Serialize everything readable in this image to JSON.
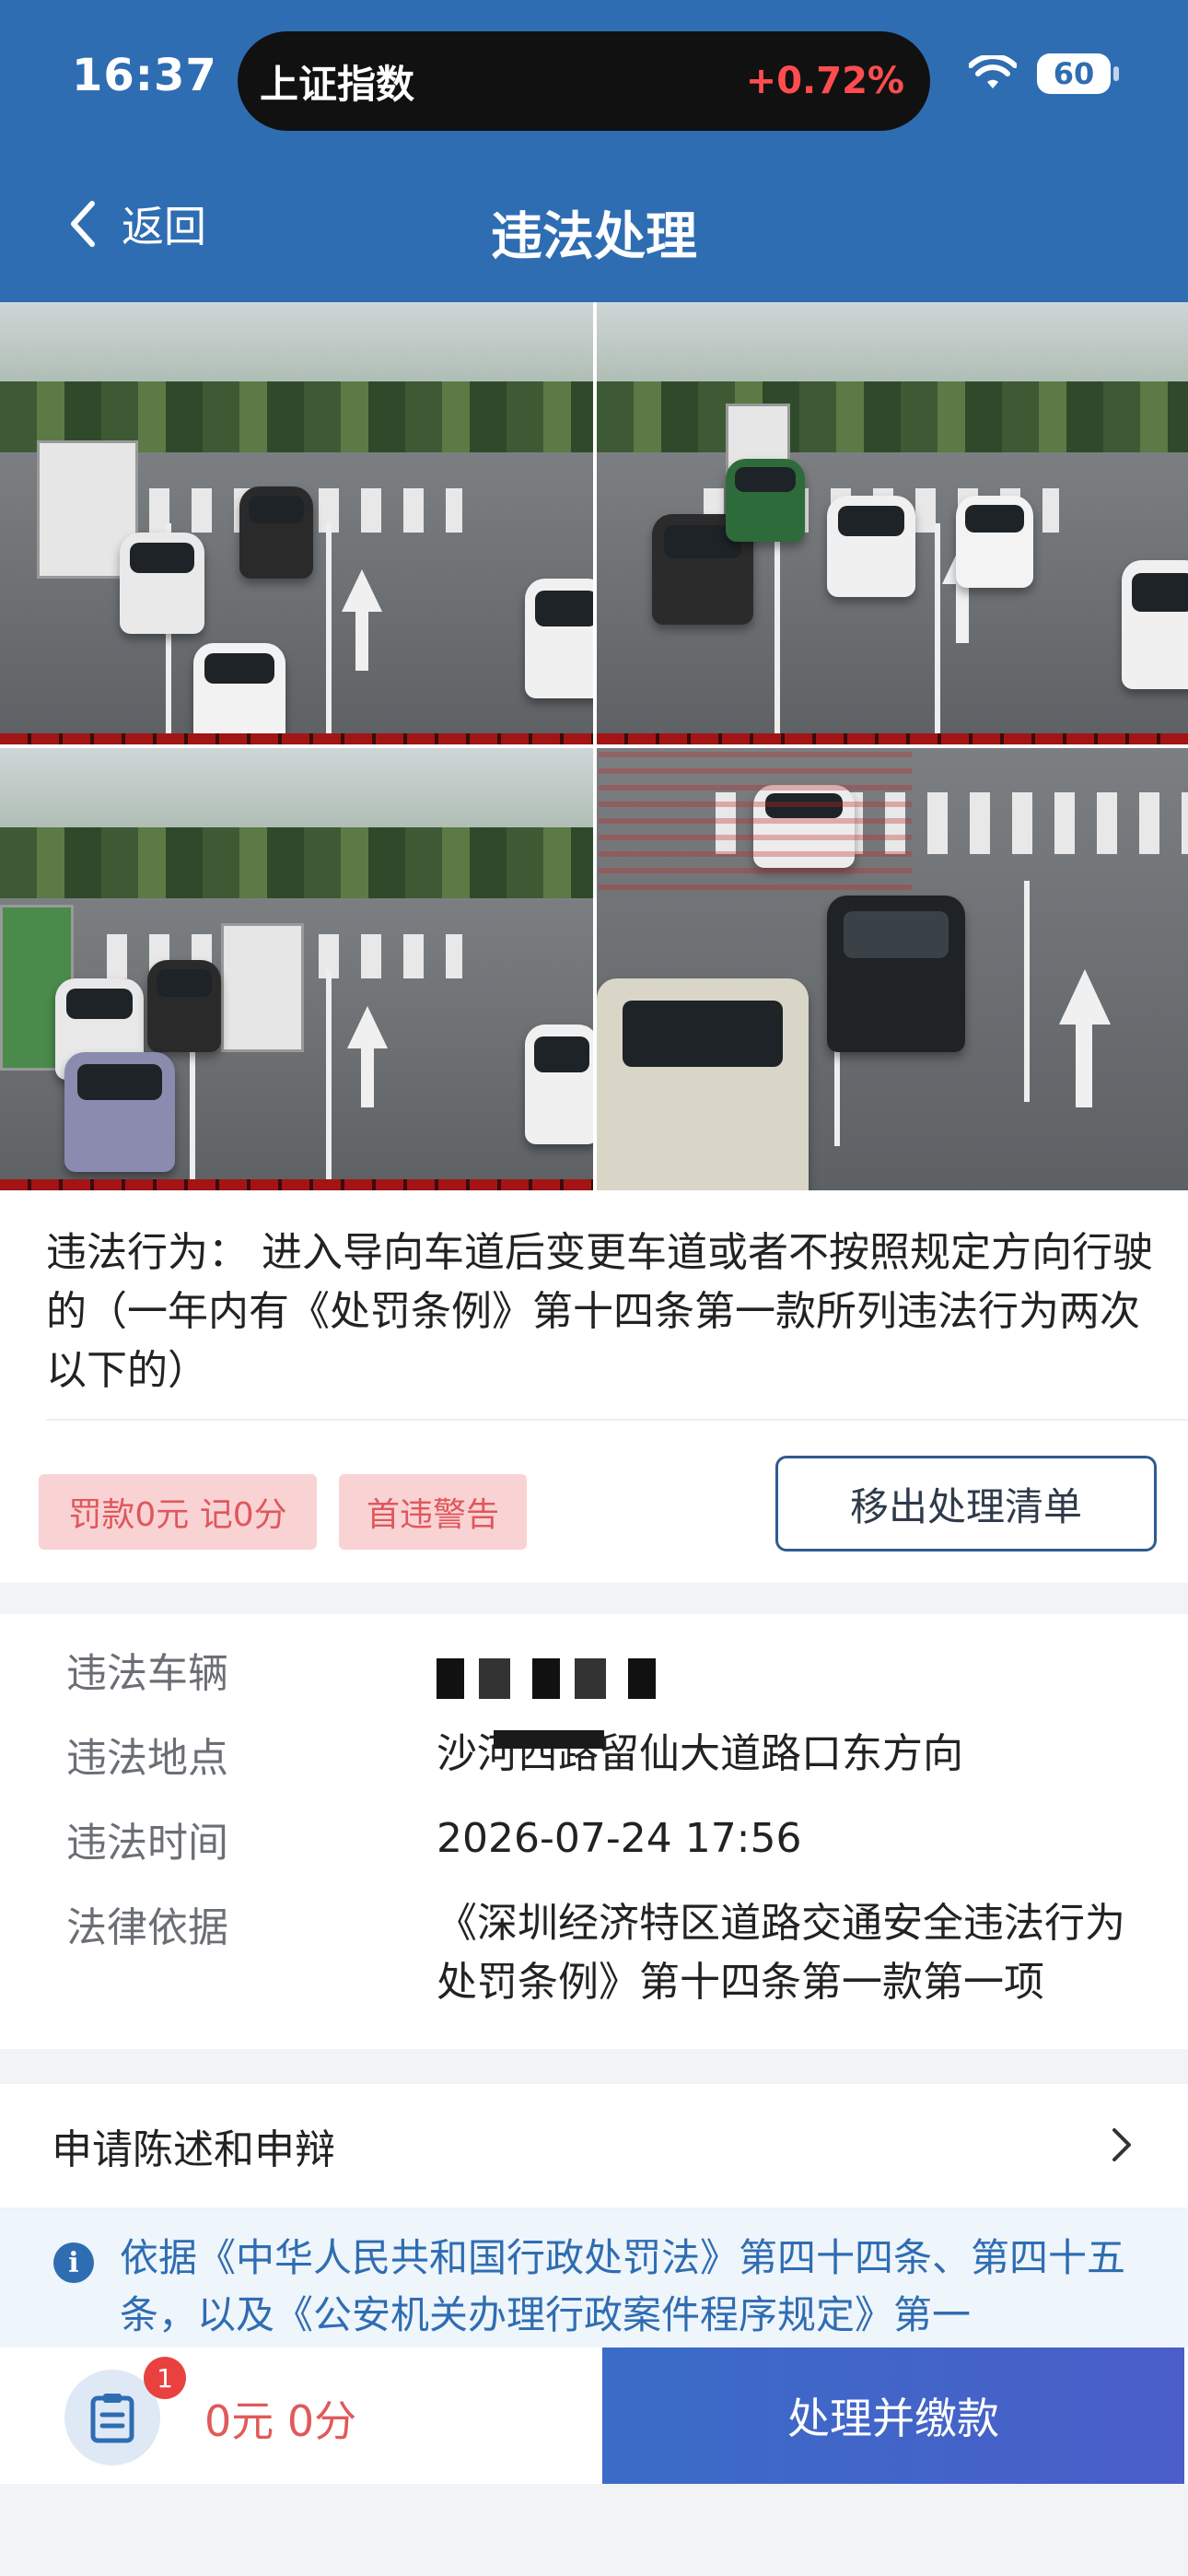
{
  "status_bar": {
    "time": "16:37",
    "ticker_name": "上证指数",
    "ticker_change": "+0.72%",
    "battery": "60"
  },
  "header": {
    "back_label": "返回",
    "title": "违法处理"
  },
  "violation": {
    "label": "违法行为：",
    "description": "进入导向车道后变更车道或者不按照规定方向行驶的（一年内有《处罚条例》第十四条第一款所列违法行为两次以下的）",
    "tags": [
      "罚款0元 记0分",
      "首违警告"
    ],
    "remove_button": "移出处理清单"
  },
  "details": {
    "vehicle_label": "违法车辆",
    "vehicle_value": "",
    "location_label": "违法地点",
    "location_value": "沙河西路留仙大道路口东方向",
    "time_label": "违法时间",
    "time_value": "2026-07-24 17:56",
    "basis_label": "法律依据",
    "basis_value": "《深圳经济特区道路交通安全违法行为处罚条例》第十四条第一款第一项"
  },
  "appeal": {
    "label": "申请陈述和申辩"
  },
  "notice": {
    "text": "依据《中华人民共和国行政处罚法》第四十四条、第四十五条，以及《公安机关办理行政案件程序规定》第一"
  },
  "bottom_bar": {
    "badge_count": "1",
    "total": "0元  0分",
    "pay_button": "处理并缴款"
  },
  "colors": {
    "header_blue": "#2f6db2",
    "tag_bg": "#f9d3d4",
    "tag_text": "#e0575c",
    "pay_button": "#3a6cc7"
  }
}
